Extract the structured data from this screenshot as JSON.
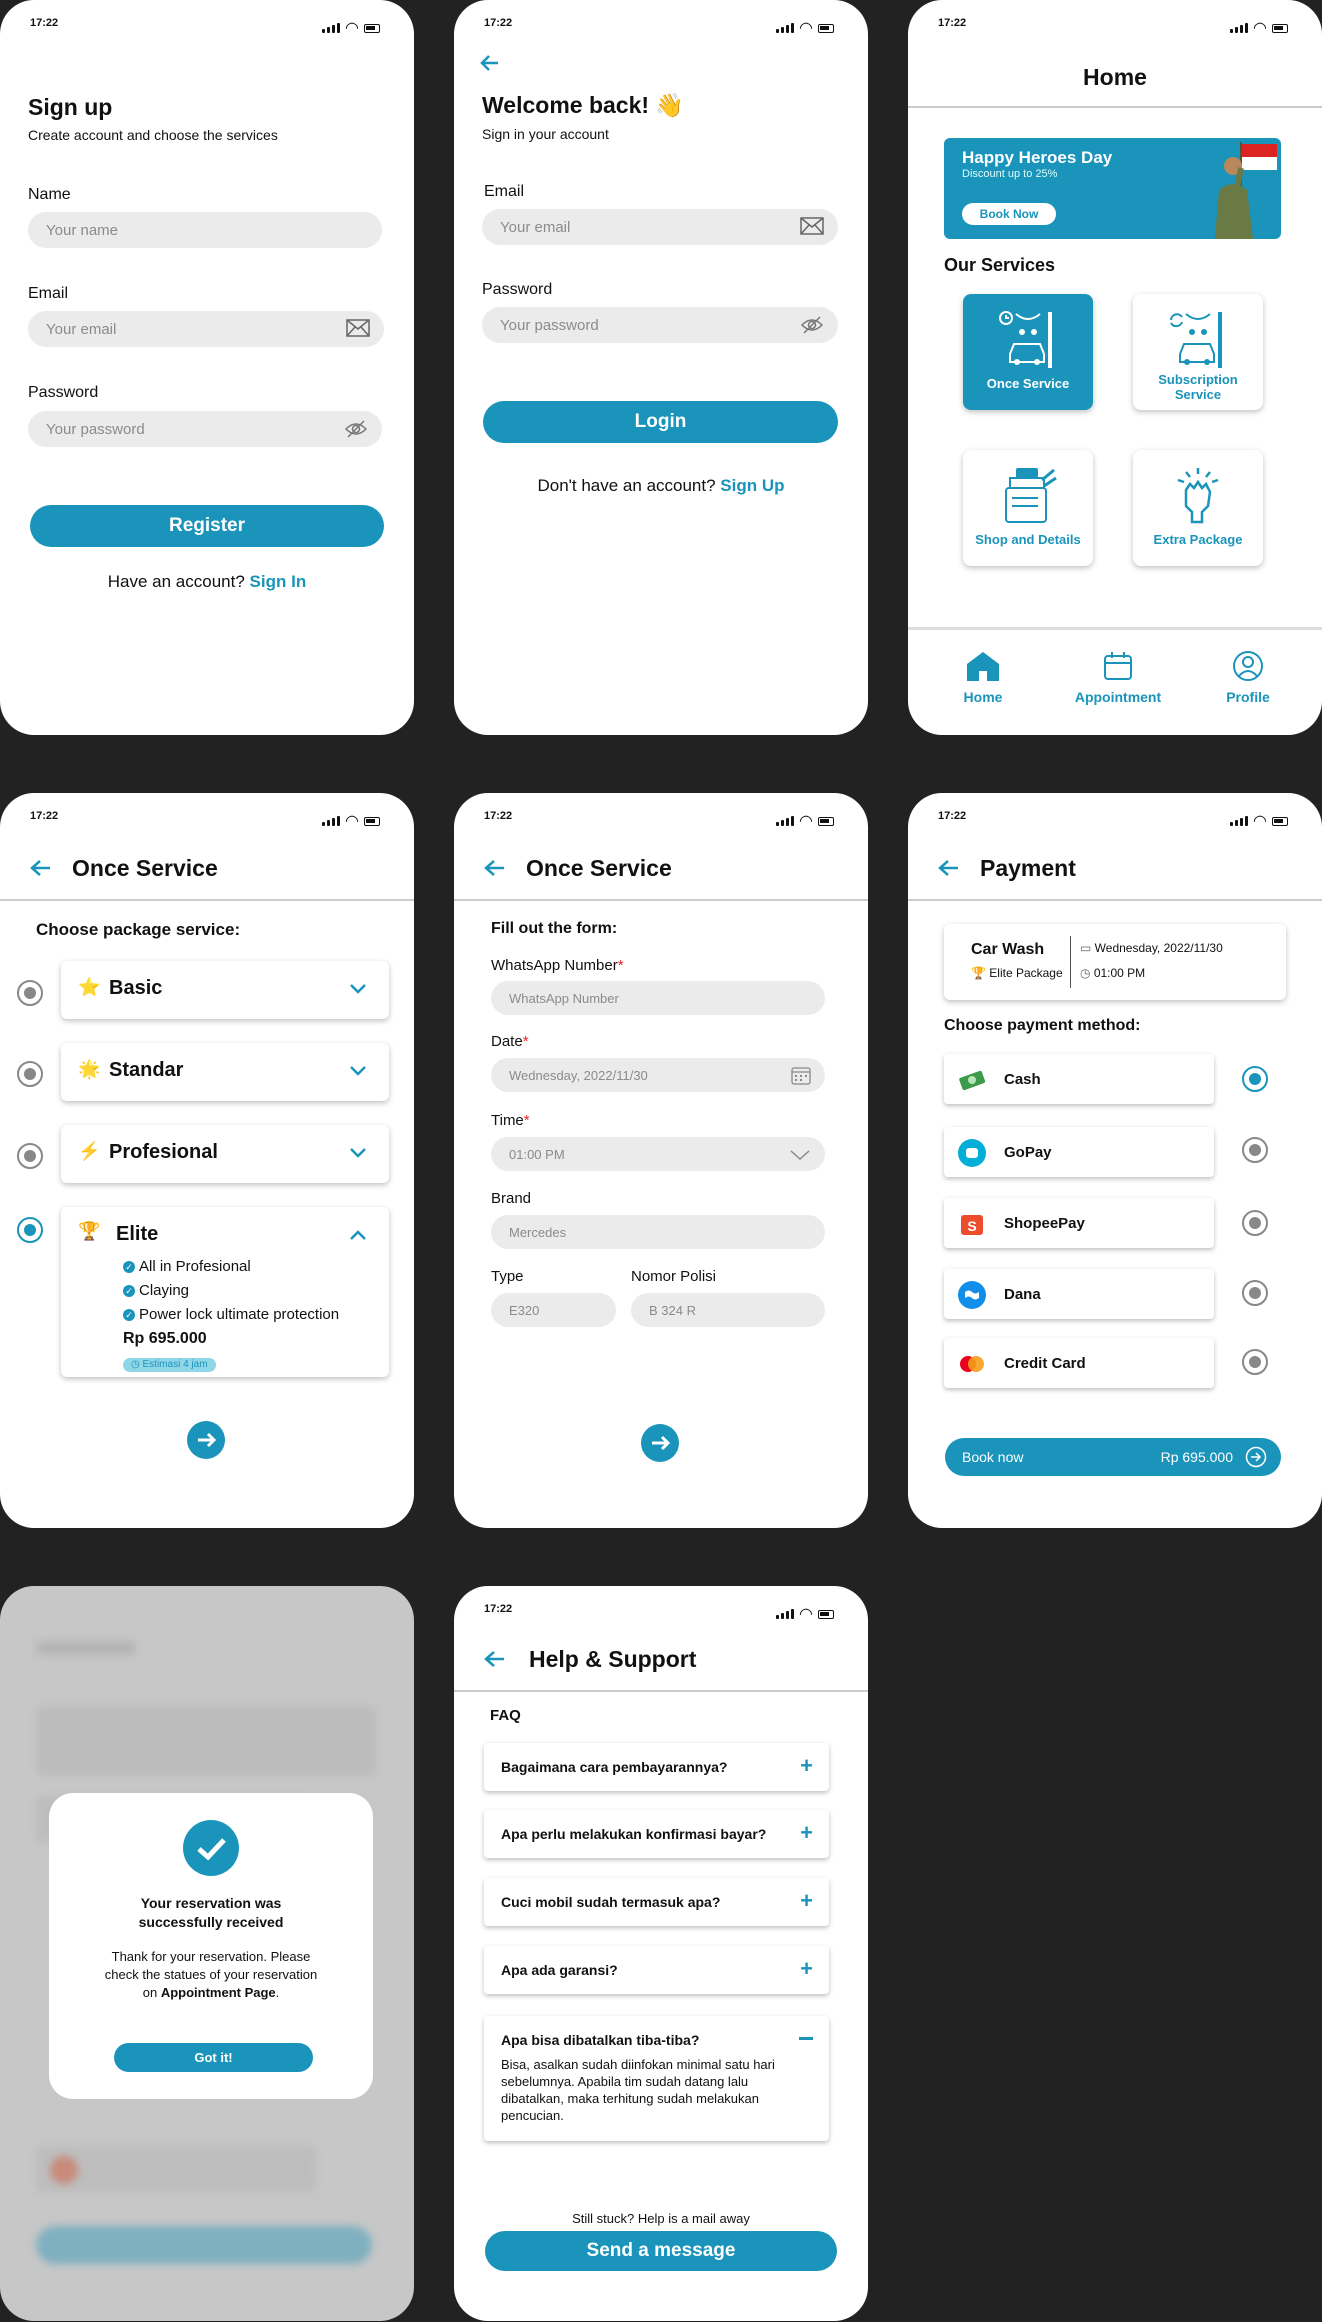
{
  "status_time": "17:22",
  "signup": {
    "title": "Sign up",
    "subtitle": "Create account and choose the services",
    "name_label": "Name",
    "name_ph": "Your name",
    "email_label": "Email",
    "email_ph": "Your email",
    "password_label": "Password",
    "password_ph": "Your password",
    "register": "Register",
    "have_account": "Have an account?",
    "sign_in": "Sign In"
  },
  "login": {
    "title": "Welcome back! 👋",
    "subtitle": "Sign in your account",
    "email_label": "Email",
    "email_ph": "Your email",
    "password_label": "Password",
    "password_ph": "Your password",
    "login": "Login",
    "no_account": "Don't have an account?",
    "sign_up": "Sign Up"
  },
  "home": {
    "title": "Home",
    "banner_title": "Happy Heroes Day",
    "banner_sub": "Discount up to 25%",
    "banner_btn": "Book Now",
    "services_title": "Our Services",
    "services": [
      {
        "label": "Once Service",
        "icon": "car-wash-timer-icon"
      },
      {
        "label": "Subscription Service",
        "icon": "car-wash-repeat-icon"
      },
      {
        "label": "Shop and Details",
        "icon": "shop-icon"
      },
      {
        "label": "Extra Package",
        "icon": "hand-sparkle-icon"
      }
    ],
    "nav": [
      {
        "label": "Home",
        "icon": "home-icon"
      },
      {
        "label": "Appointment",
        "icon": "calendar-icon"
      },
      {
        "label": "Profile",
        "icon": "profile-icon"
      }
    ]
  },
  "once": {
    "title": "Once Service",
    "choose": "Choose package service:",
    "packages": [
      {
        "name": "Basic",
        "icon": "⭐"
      },
      {
        "name": "Standar",
        "icon": "🌟"
      },
      {
        "name": "Profesional",
        "icon": "⚡"
      },
      {
        "name": "Elite",
        "icon": "🏆"
      }
    ],
    "elite_features": [
      "All in Profesional",
      "Claying",
      "Power lock ultimate protection"
    ],
    "elite_price": "Rp 695.000",
    "elite_est": "Estimasi 4 jam"
  },
  "form": {
    "title": "Once Service",
    "heading": "Fill out the form:",
    "wa_label": "WhatsApp Number",
    "wa_ph": "WhatsApp Number",
    "date_label": "Date",
    "date_val": "Wednesday, 2022/11/30",
    "time_label": "Time",
    "time_val": "01:00 PM",
    "brand_label": "Brand",
    "brand_val": "Mercedes",
    "type_label": "Type",
    "type_val": "E320",
    "plate_label": "Nomor Polisi",
    "plate_val": "B 324 R",
    "required": "*"
  },
  "payment": {
    "title": "Payment",
    "service": "Car Wash",
    "package": "Elite Package",
    "date": "Wednesday, 2022/11/30",
    "time": "01:00 PM",
    "choose": "Choose payment method:",
    "methods": [
      {
        "label": "Cash",
        "icon": "cash-icon"
      },
      {
        "label": "GoPay",
        "icon": "gopay-icon"
      },
      {
        "label": "ShopeePay",
        "icon": "shopeepay-icon"
      },
      {
        "label": "Dana",
        "icon": "dana-icon"
      },
      {
        "label": "Credit Card",
        "icon": "credit-card-icon"
      }
    ],
    "book": "Book now",
    "total": "Rp 695.000"
  },
  "success": {
    "title": "Your reservation was successfully received",
    "body1": "Thank for your reservation. Please check the statues of your reservation on",
    "body_bold": "Appointment Page",
    "body_end": ".",
    "btn": "Got it!"
  },
  "help": {
    "title": "Help & Support",
    "faq": "FAQ",
    "questions": [
      "Bagaimana cara pembayarannya?",
      "Apa perlu melakukan konfirmasi bayar?",
      "Cuci mobil sudah termasuk apa?",
      "Apa ada garansi?",
      "Apa bisa dibatalkan tiba-tiba?"
    ],
    "answer": "Bisa, asalkan sudah diinfokan minimal satu hari sebelumnya. Apabila tim sudah datang lalu dibatalkan, maka terhitung sudah melakukan pencucian.",
    "stuck": "Still stuck? Help is a mail away",
    "send": "Send a message"
  },
  "colors": {
    "accent": "#1a94ba",
    "background": "#222222",
    "field": "#ebebeb"
  }
}
